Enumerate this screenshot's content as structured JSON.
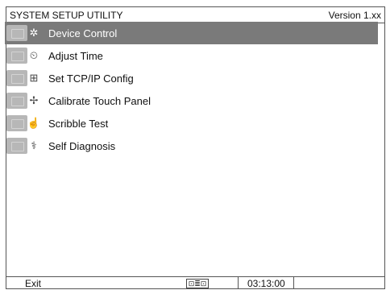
{
  "header": {
    "title": "SYSTEM SETUP UTILITY",
    "version": "Version 1.xx"
  },
  "menu": {
    "items": [
      {
        "label": "Device Control",
        "icon": "device-control-icon",
        "selected": true
      },
      {
        "label": "Adjust Time",
        "icon": "clock-icon",
        "selected": false
      },
      {
        "label": "Set TCP/IP Config",
        "icon": "network-icon",
        "selected": false
      },
      {
        "label": "Calibrate Touch Panel",
        "icon": "calibrate-icon",
        "selected": false
      },
      {
        "label": "Scribble Test",
        "icon": "scribble-icon",
        "selected": false
      },
      {
        "label": "Self Diagnosis",
        "icon": "diagnosis-icon",
        "selected": false
      }
    ]
  },
  "status": {
    "exit_label": "Exit",
    "network_icon": "network-status-icon",
    "time": "03:13:00"
  },
  "colors": {
    "selected_bg": "#7a7a7a",
    "icon_tile": "#b7b7b7",
    "border": "#555555"
  }
}
